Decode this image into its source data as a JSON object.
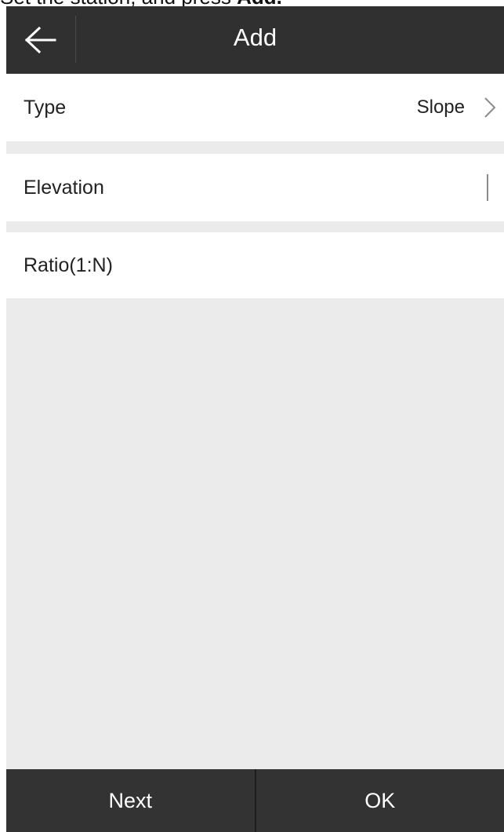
{
  "caption": {
    "text_prefix": "Set the station, and press ",
    "text_bold": "Add."
  },
  "header": {
    "back_icon": "arrow-left-icon",
    "title": "Add"
  },
  "form": {
    "type_label": "Type",
    "type_value": "Slope",
    "type_chevron_icon": "chevron-right-icon",
    "elevation_label": "Elevation",
    "elevation_value": "",
    "ratio_label": "Ratio(1:N)",
    "ratio_value": ""
  },
  "footer": {
    "next_label": "Next",
    "ok_label": "OK"
  },
  "colors": {
    "titlebar": "#303030",
    "footer": "#333333",
    "background": "#ebebeb",
    "row": "#ffffff"
  }
}
